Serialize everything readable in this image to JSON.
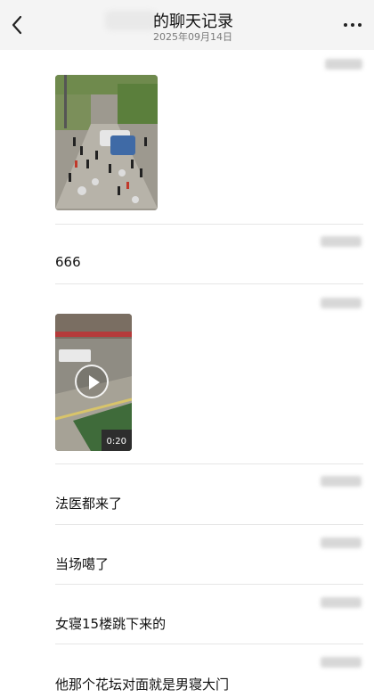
{
  "header": {
    "title": "的聊天记录",
    "subtitle": "2025年09月14日",
    "back_icon": "chevron-left-icon",
    "more_icon": "more-dots-icon"
  },
  "messages": [
    {
      "type": "image",
      "sender_time": ""
    },
    {
      "type": "text",
      "text": "666"
    },
    {
      "type": "video",
      "duration": "0:20"
    },
    {
      "type": "text",
      "text": "法医都来了"
    },
    {
      "type": "text",
      "text": "当场噶了"
    },
    {
      "type": "text",
      "text": "女寝15楼跳下来的"
    },
    {
      "type": "text",
      "text": "他那个花坛对面就是男寝大门"
    }
  ],
  "colors": {
    "header_bg": "#f4f4f4",
    "divider": "#e6e6e6",
    "text": "#111111",
    "subtext": "#7a7a7a"
  }
}
